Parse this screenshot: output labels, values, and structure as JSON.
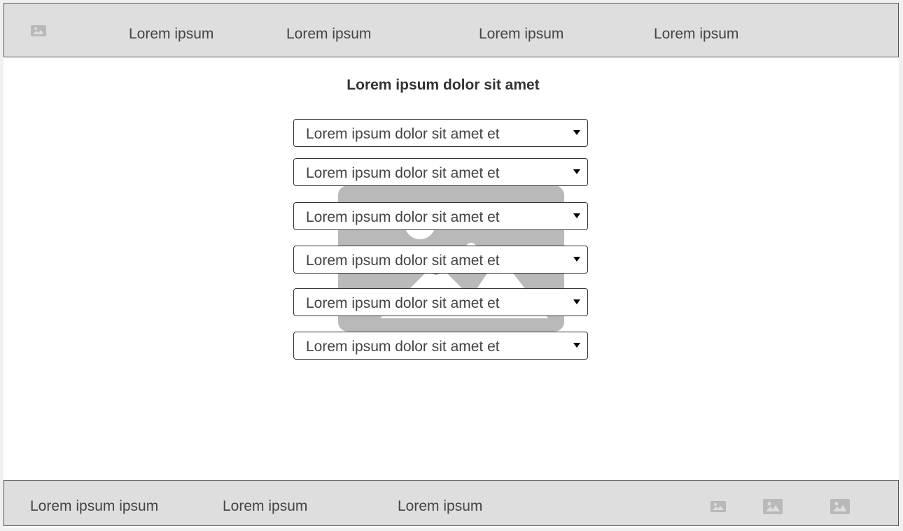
{
  "header": {
    "logo_icon": "image-placeholder-icon",
    "nav": [
      "Lorem ipsum",
      "Lorem ipsum",
      "Lorem ipsum",
      "Lorem ipsum"
    ]
  },
  "main": {
    "title": "Lorem ipsum dolor sit amet",
    "background_icon": "image-placeholder-icon",
    "selects": [
      "Lorem ipsum dolor sit amet et",
      "Lorem ipsum dolor sit amet et",
      "Lorem ipsum dolor sit amet et",
      "Lorem ipsum dolor sit amet et",
      "Lorem ipsum dolor sit amet et",
      "Lorem ipsum dolor sit amet et"
    ]
  },
  "footer": {
    "links": [
      "Lorem ipsum ipsum",
      "Lorem ipsum",
      "Lorem ipsum"
    ],
    "icons": [
      "image-placeholder-icon",
      "image-placeholder-icon",
      "image-placeholder-icon"
    ]
  },
  "colors": {
    "bar_background": "#dedede",
    "page_background": "#ffffff",
    "placeholder_gray": "#b9b9b9",
    "text": "#444444"
  }
}
